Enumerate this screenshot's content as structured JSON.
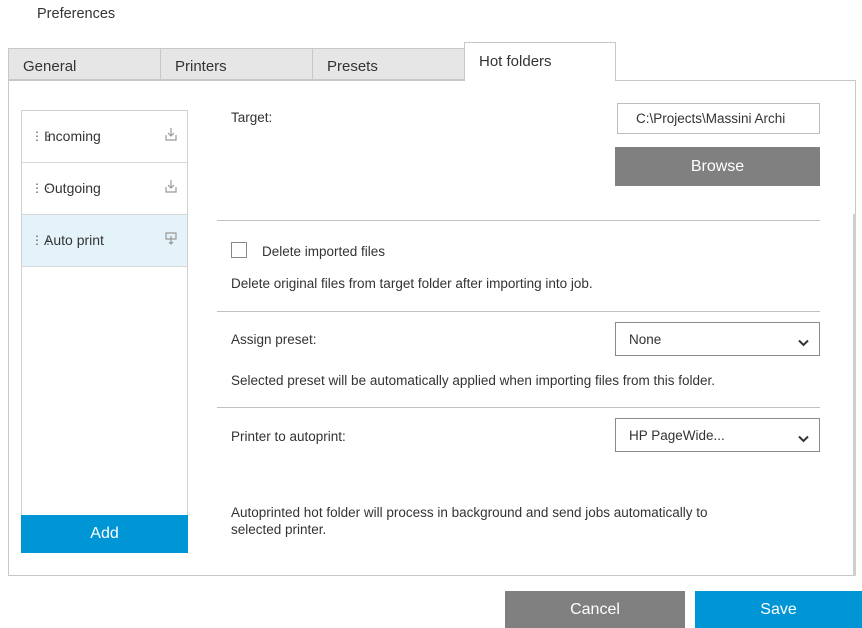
{
  "window": {
    "title": "Preferences"
  },
  "tabs": [
    {
      "label": "General"
    },
    {
      "label": "Printers"
    },
    {
      "label": "Presets"
    },
    {
      "label": "Hot folders"
    }
  ],
  "active_tab": "Hot folders",
  "hot_folders": {
    "items": [
      {
        "label": "Incoming",
        "icon": "import-icon"
      },
      {
        "label": "Outgoing",
        "icon": "import-icon"
      },
      {
        "label": "Auto print",
        "icon": "autoprint-icon",
        "selected": true
      }
    ],
    "add_label": "Add"
  },
  "settings": {
    "target_label": "Target:",
    "target_value": "C:\\Projects\\Massini Archi",
    "browse_label": "Browse",
    "delete_imported_label": "Delete imported files",
    "delete_imported_checked": false,
    "delete_imported_desc": "Delete original files from target folder after importing into job.",
    "assign_preset_label": "Assign preset:",
    "assign_preset_value": "None",
    "assign_preset_desc": "Selected preset will be automatically applied when importing files from this folder.",
    "printer_label": "Printer to autoprint:",
    "printer_value": "HP PageWide...",
    "autoprint_desc_line1": "Autoprinted hot folder will process in background and send jobs automatically to",
    "autoprint_desc_line2": "selected printer."
  },
  "footer": {
    "cancel_label": "Cancel",
    "save_label": "Save"
  },
  "colors": {
    "accent": "#0096d6",
    "secondary_button": "#808080",
    "selected_row": "#e4f3f9"
  }
}
